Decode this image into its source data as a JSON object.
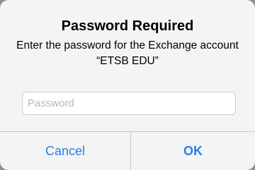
{
  "alert": {
    "title": "Password Required",
    "message": "Enter the password for the Exchange account “ETSB EDU”",
    "password_field": {
      "value": "",
      "placeholder": "Password"
    },
    "buttons": {
      "cancel_label": "Cancel",
      "ok_label": "OK"
    },
    "accent_color": "#2f7de1"
  }
}
